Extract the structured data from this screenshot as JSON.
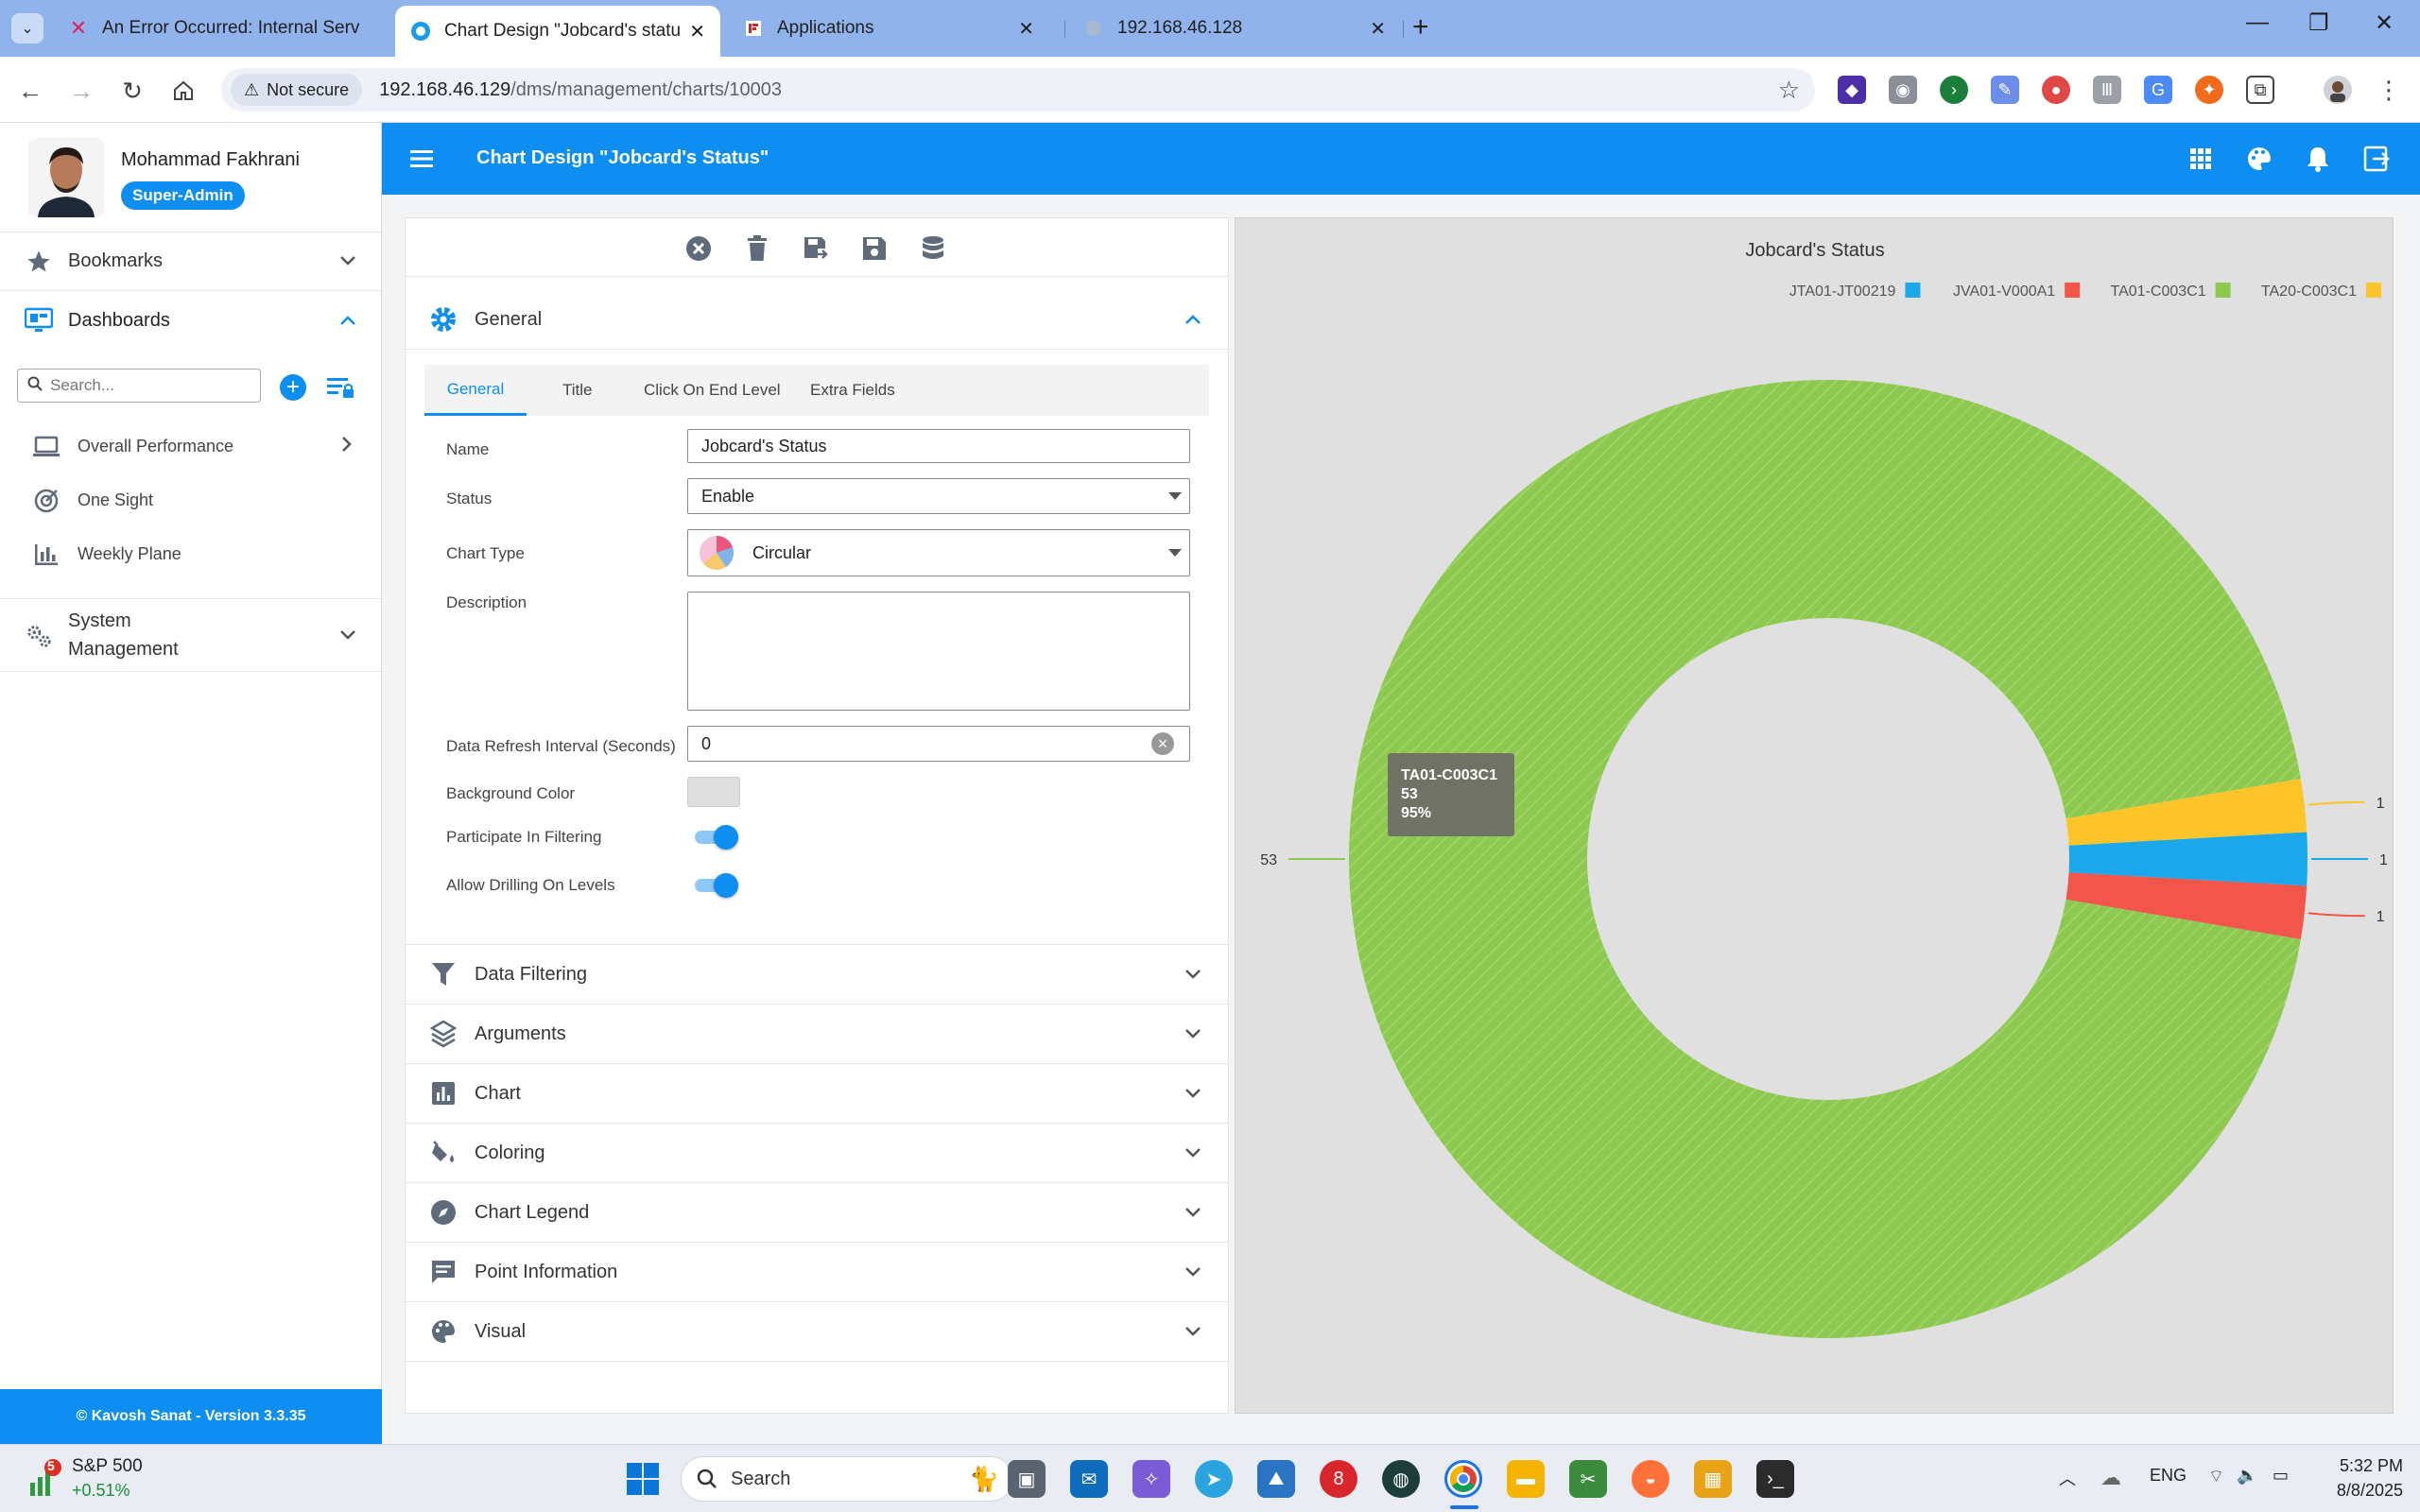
{
  "browser": {
    "tabs": [
      {
        "label": "An Error Occurred: Internal Serv",
        "active": false
      },
      {
        "label": "Chart Design \"Jobcard's status\"",
        "active": true
      },
      {
        "label": "Applications",
        "active": false
      },
      {
        "label": "192.168.46.128",
        "active": false
      }
    ],
    "not_secure": "Not secure",
    "url_host": "192.168.46.129",
    "url_path": "/dms/management/charts/10003"
  },
  "sidebar": {
    "user_name": "Mohammad Fakhrani",
    "role": "Super-Admin",
    "bookmarks_label": "Bookmarks",
    "dashboards_label": "Dashboards",
    "search_placeholder": "Search...",
    "dashboard_items": [
      {
        "label": "Overall Performance",
        "icon": "laptop-icon"
      },
      {
        "label": "One Sight",
        "icon": "target-icon"
      },
      {
        "label": "Weekly Plane",
        "icon": "bar-chart-icon"
      }
    ],
    "system_label_1": "System",
    "system_label_2": "Management",
    "footer": "© Kavosh Sanat - Version 3.3.35"
  },
  "header": {
    "title": "Chart Design \"Jobcard's Status\""
  },
  "editor": {
    "general_label": "General",
    "tabs": [
      "General",
      "Title",
      "Click On End Level",
      "Extra Fields"
    ],
    "fields": {
      "name_label": "Name",
      "name_value": "Jobcard's Status",
      "status_label": "Status",
      "status_value": "Enable",
      "chart_type_label": "Chart Type",
      "chart_type_value": "Circular",
      "description_label": "Description",
      "description_value": "",
      "refresh_label": "Data Refresh Interval (Seconds)",
      "refresh_value": "0",
      "bg_color_label": "Background Color",
      "bg_color_value": "#dedede",
      "filtering_label": "Participate In Filtering",
      "filtering_on": true,
      "drilling_label": "Allow Drilling On Levels",
      "drilling_on": true
    },
    "sections": [
      {
        "label": "Data Filtering",
        "icon": "filter-icon"
      },
      {
        "label": "Arguments",
        "icon": "layers-icon"
      },
      {
        "label": "Chart",
        "icon": "chart-icon"
      },
      {
        "label": "Coloring",
        "icon": "paint-bucket-icon"
      },
      {
        "label": "Chart Legend",
        "icon": "compass-icon"
      },
      {
        "label": "Point Information",
        "icon": "comment-icon"
      },
      {
        "label": "Visual",
        "icon": "palette-icon"
      }
    ]
  },
  "chart_data": {
    "type": "pie",
    "title": "Jobcard's Status",
    "legend_position": "top-right",
    "categories": [
      "JTA01-JT00219",
      "JVA01-V000A1",
      "TA01-C003C1",
      "TA20-C003C1"
    ],
    "values": [
      1,
      1,
      53,
      1
    ],
    "colors": [
      "#1aa7ec",
      "#f2554a",
      "#8dc850",
      "#fdc52a"
    ],
    "tooltip": {
      "label": "TA01-C003C1",
      "value": "53",
      "percent": "95%"
    }
  },
  "taskbar": {
    "stock_name": "S&P 500",
    "stock_change": "+0.51%",
    "stock_badge": "5",
    "search_label": "Search",
    "language": "ENG",
    "time": "5:32 PM",
    "date": "8/8/2025"
  }
}
